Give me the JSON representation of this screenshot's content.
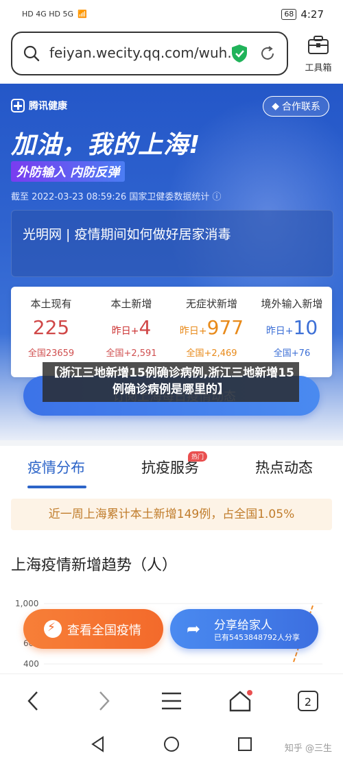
{
  "status_bar": {
    "signal_text": "HD 4G HD 5G",
    "battery": "68",
    "time": "4:27"
  },
  "address_bar": {
    "url": "feiyan.wecity.qq.com/wuh...",
    "toolbox_label": "工具箱"
  },
  "hero": {
    "brand": "腾讯健康",
    "contact": "合作联系",
    "slogan": "加油，我的上海!",
    "tag": "外防输入 内防反弹",
    "as_of": "截至 2022-03-23 08:59:26 国家卫健委数据统计 ⓘ",
    "news_card": "光明网 | 疫情期间如何做好居家消毒"
  },
  "stats": [
    {
      "label": "本土现有",
      "value": "225",
      "prefix": "",
      "total": "全国23659"
    },
    {
      "label": "本土新增",
      "value": "4",
      "prefix": "昨日+",
      "total": "全国+2,591"
    },
    {
      "label": "无症状新增",
      "value": "977",
      "prefix": "昨日+",
      "total": "全国+2,469"
    },
    {
      "label": "境外输入新增",
      "value": "10",
      "prefix": "昨日+",
      "total": "全国+76"
    }
  ],
  "subscribe_button": "订阅上海每日疫情动态",
  "overlay_caption": "【浙江三地新增15例确诊病例,浙江三地新增15例确诊病例是哪里的】",
  "tabs": [
    {
      "label": "疫情分布",
      "active": true
    },
    {
      "label": "抗疫服务",
      "badge": "热门"
    },
    {
      "label": "热点动态"
    }
  ],
  "weekly_notice": "近一周上海累计本土新增149例，占全国1.05%",
  "trend_title": "上海疫情新增趋势（人）",
  "chart_data": {
    "type": "line",
    "title": "上海疫情新增趋势（人）",
    "y_ticks": [
      "1,000",
      "600",
      "400"
    ],
    "series": [
      {
        "values": [
          980,
          420
        ]
      }
    ]
  },
  "fab_left": "查看全国疫情",
  "fab_right": {
    "title": "分享给家人",
    "subtitle": "已有5453848792人分享"
  },
  "nav": {
    "tab_count": "2"
  },
  "watermark": "知乎 @三生",
  "colors": {
    "accent": "#2c64c8",
    "hero_blue": "#2457c8",
    "orange": "#f36a2b",
    "red": "#d05050"
  }
}
